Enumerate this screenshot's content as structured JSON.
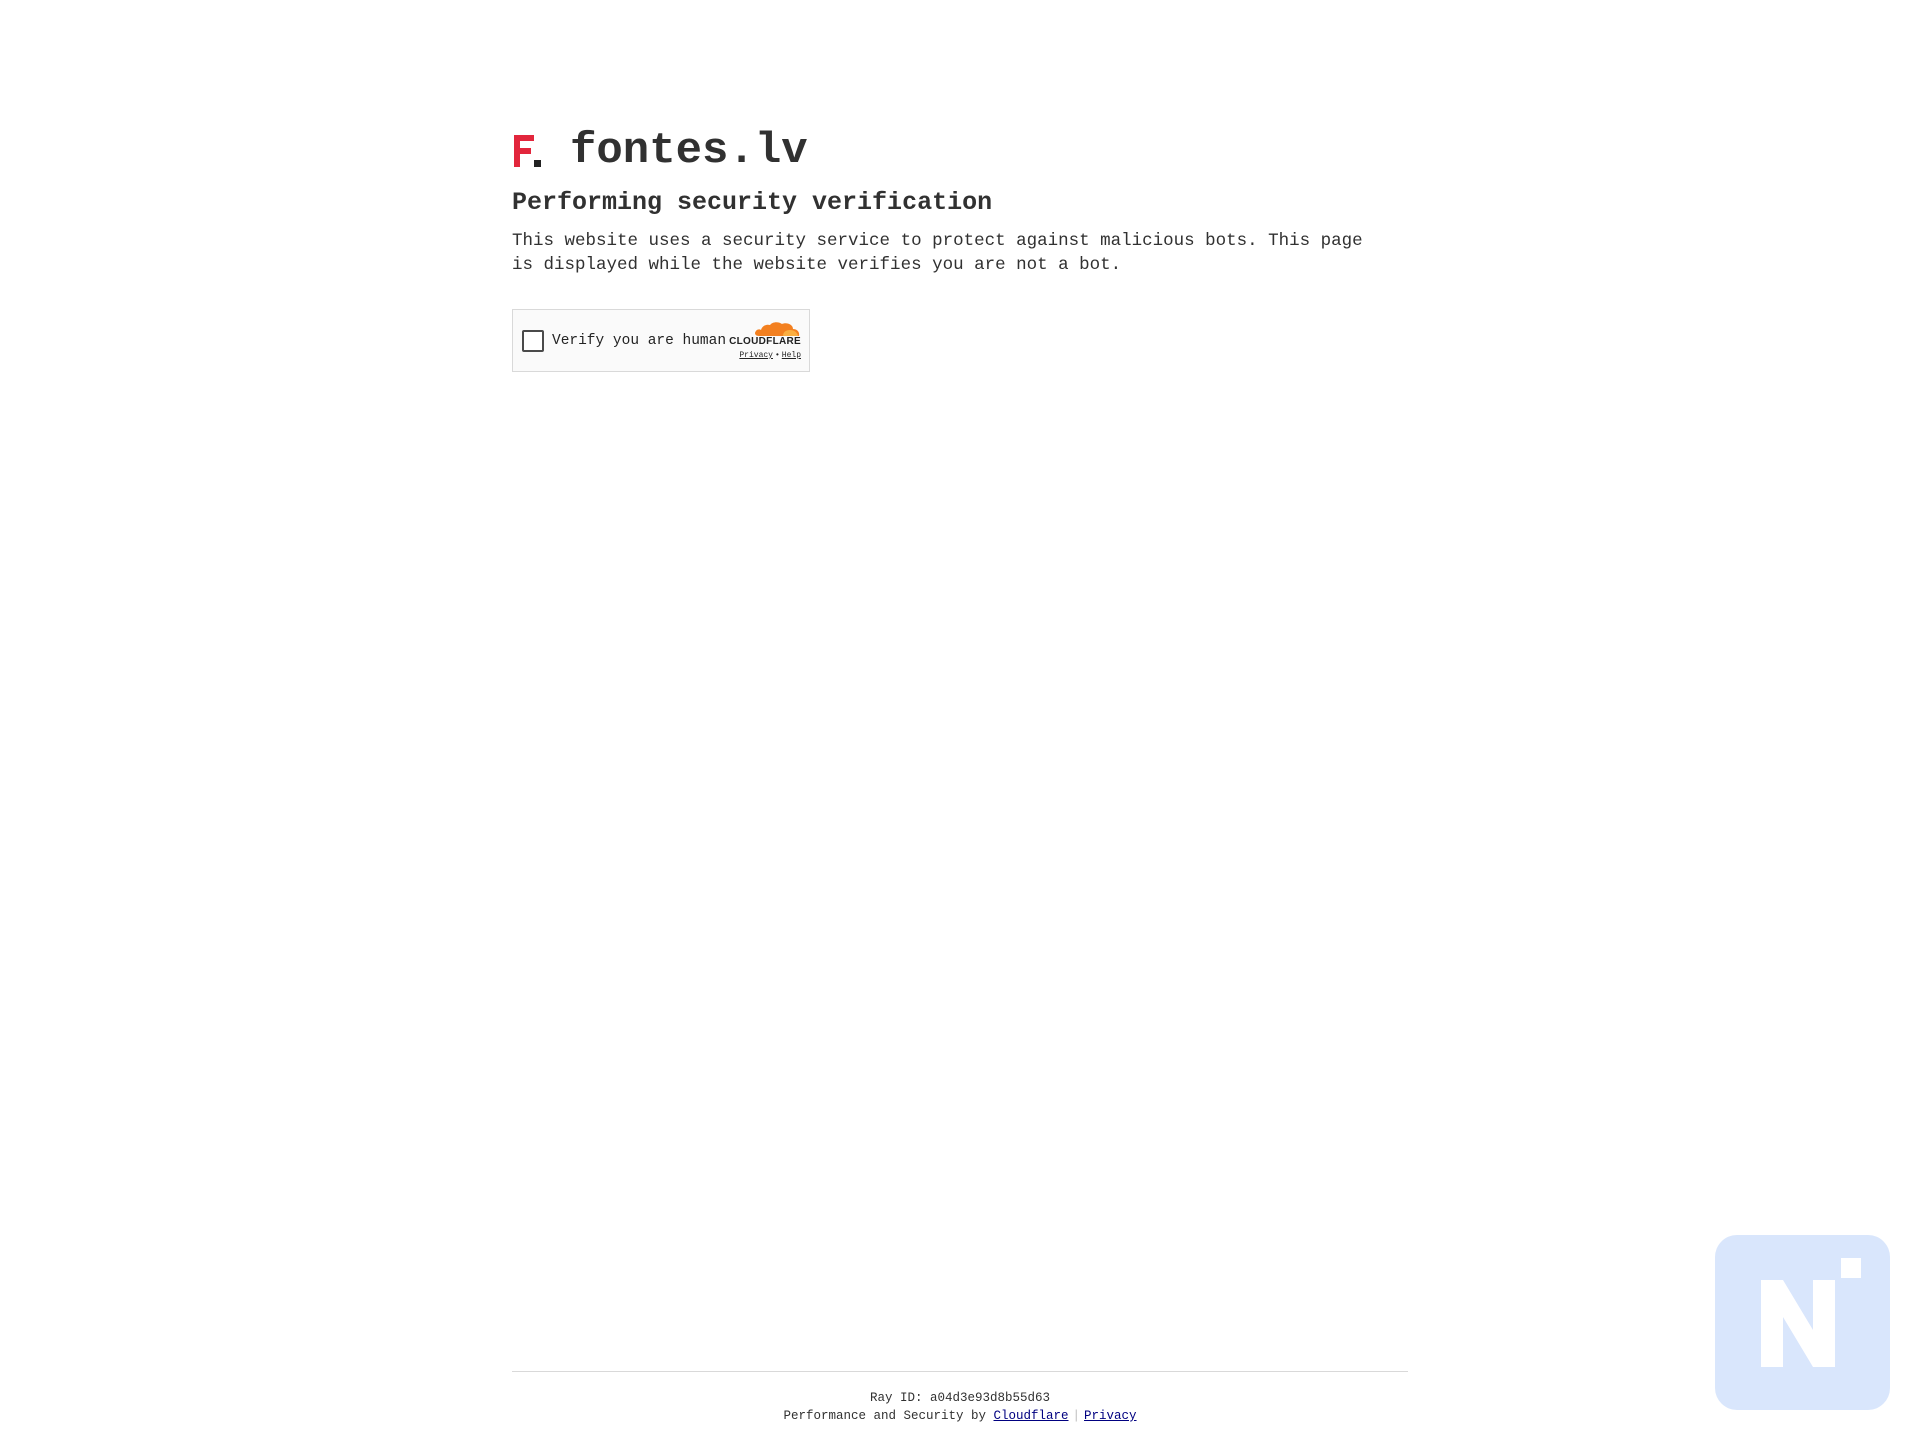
{
  "site": {
    "name": "fontes.lv",
    "logo_icon": "fontes-logo-icon",
    "logo_colors": [
      "#e2263c",
      "#222222"
    ]
  },
  "headline": "Performing security verification",
  "description": "This website uses a security service to protect against malicious bots. This page is displayed while the website verifies you are not a bot.",
  "widget": {
    "label": "Verify you are human",
    "checked": false,
    "brand": "CLOUDFLARE",
    "brand_icon": "cloudflare-cloud-icon",
    "brand_color": "#f38020",
    "privacy_link": "Privacy",
    "links_separator": "•",
    "help_link": "Help"
  },
  "footer": {
    "ray_id": "Ray ID: a04d3e93d8b55d63",
    "performance_text": "Performance and Security by",
    "cloudflare_link": "Cloudflare",
    "separator": "|",
    "privacy_link": "Privacy",
    "link_color": "#000080"
  },
  "badge": {
    "icon": "n-badge-icon",
    "color": "#d9e6fc"
  }
}
